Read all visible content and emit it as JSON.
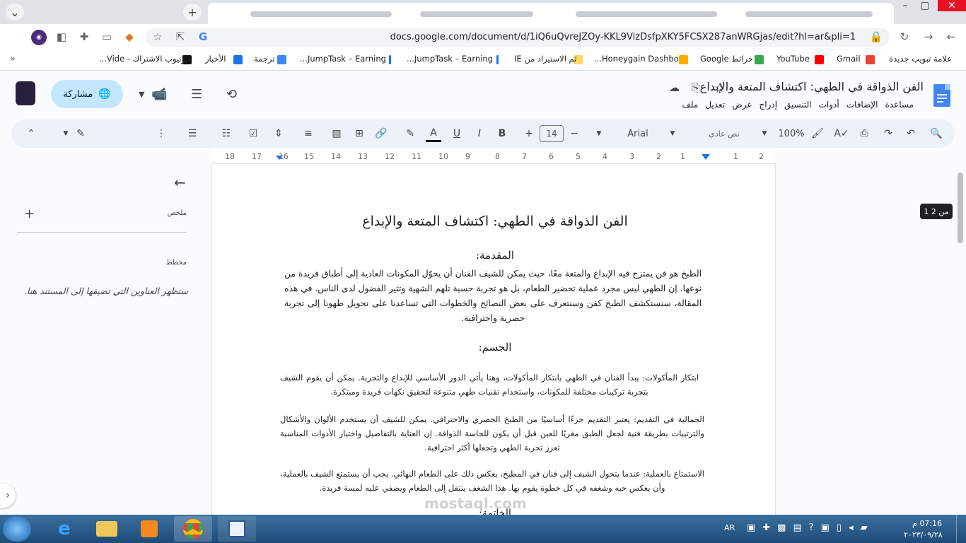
{
  "browser": {
    "url": "docs.google.com/document/d/1iQ6uQvreJZOy-KKL9VizDsfpXKY5FCSX287anWRGjas/edit?hl=ar&pli=1",
    "new_tab": "+",
    "bookmarks": [
      "علامة تبويب جديدة",
      "Gmail",
      "YouTube",
      "خرائط Google",
      "Honeygain Dashbo...",
      "ثم الاستيراد من IE",
      "JumpTask – Earning...",
      "JumpTask – Earning...",
      "ترجمة",
      "الأخبار",
      "يوتيوب الاشتراك - Vide..."
    ]
  },
  "docs": {
    "title": "الفن الذواقة في الطهي: اكتشاف المتعة والإبداع",
    "menu": [
      "ملف",
      "تعديل",
      "عرض",
      "إدراج",
      "التنسيق",
      "أدوات",
      "الإضافات",
      "مساعدة"
    ],
    "share_label": "مشاركة",
    "zoom": "100%",
    "style": "نص عادي",
    "font": "Arial",
    "font_size": "14",
    "ruler": [
      "2",
      "1",
      "1",
      "2",
      "3",
      "4",
      "5",
      "6",
      "7",
      "8",
      "9",
      "10",
      "11",
      "12",
      "13",
      "14",
      "15",
      "16",
      "17",
      "18"
    ]
  },
  "sidepanel": {
    "summary_label": "ملخص",
    "summary_add": "+",
    "outline_label": "مخطط",
    "outline_hint": "ستظهر العناوين التي تضيفها إلى المستند هنا."
  },
  "document": {
    "heading": "الفن الذواقة في الطهي: اكتشاف المتعة والإبداع",
    "intro_title": "المقدمة:",
    "intro_text": "الطبخ هو فن يمتزج فيه الإبداع والمتعة معًا، حيث يمكن للشيف الفنان أن يحوّل المكونات العادية إلى أطباق فريدة من نوعها. إن الطهي ليس مجرد عملية تحضير الطعام، بل هو تجربة حسية تلهم الشهية وتثير الفضول لدى الناس. في هذه المقالة، سنستكشف الطبخ كفن وسنتعرف على بعض النصائح والخطوات التي تساعدنا على تحويل طهونا إلى تجربة حصرية واحترافية.",
    "body_title": "الجسم:",
    "p1": "ابتكار المأكولات: يبدأ الفنان في الطهي بابتكار المأكولات، وهنا يأتي الدور الأساسي للإبداع والتجربة. يمكن أن يقوم الشيف بتجربة تركيبات مختلفة للمكونات، واستخدام تقنيات طهي متنوعة لتحقيق نكهات فريدة ومبتكرة.",
    "p2": "الجمالية في التقديم: يعتبر التقديم جزءًا أساسيًا من الطبخ الحصري والاحترافي. يمكن للشيف أن يستخدم الألوان والأشكال والترتيبات بطريقة فنية لجعل الطبق مغريًا للعين قبل أن يكون للحاسة الذواقة. إن العناية بالتفاصيل واختيار الأدوات المناسبة تعزز تجربة الطهي وتجعلها أكثر احترافية.",
    "p3": "الاستمتاع بالعملية: عندما يتحول الشيف إلى فنان في المطبخ، يعكس ذلك على الطعام النهائي. يجب أن يستمتع الشيف بالعملية، وأن يعكس حبه وشغفه في كل خطوة يقوم بها. هذا الشغف ينتقل إلى الطعام ويضفي عليه لمسة فريدة.",
    "conclusion_title": "الخاتمة:",
    "page_badge": "1 من 2"
  },
  "taskbar": {
    "lang": "AR",
    "time": "07:16 م",
    "date": "٢٠٢٣/٠٩/٢٨"
  },
  "watermark": {
    "text": "mostaql.com"
  },
  "colors": {
    "share_bg": "#c2e7ff",
    "toolbar_bg": "#edf2fa",
    "docs_blue": "#4285f4",
    "taskbar": "#1d4b78"
  }
}
